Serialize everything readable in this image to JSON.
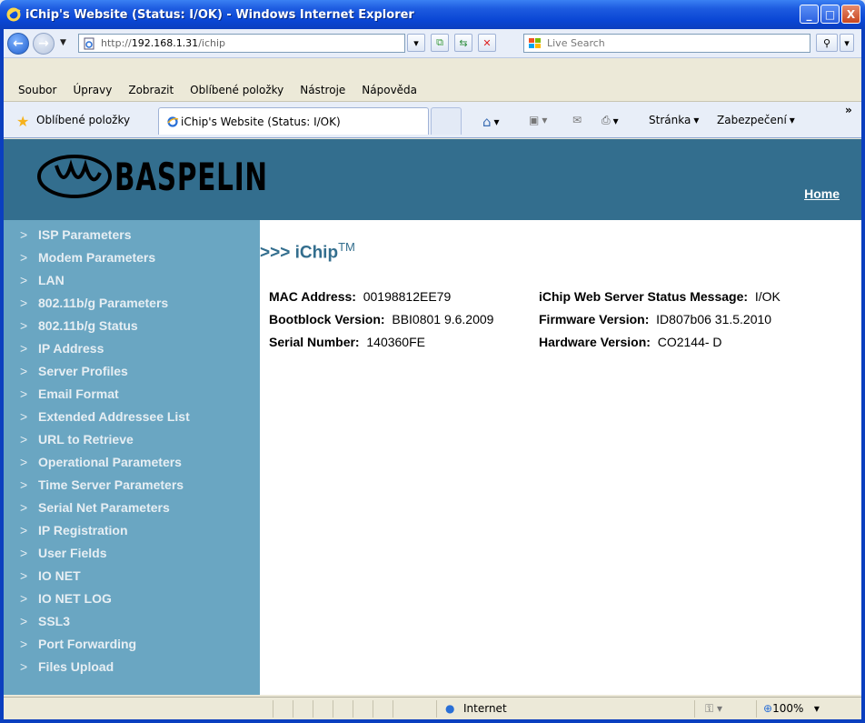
{
  "window": {
    "title": "iChip's Website (Status: I/OK) - Windows Internet Explorer",
    "buttons": [
      "_",
      "□",
      "X"
    ]
  },
  "address_bar": {
    "url_prefix": "http://",
    "url_host": "192.168.1.31",
    "url_path": "/ichip",
    "search_placeholder": "Live Search"
  },
  "menu": [
    "Soubor",
    "Úpravy",
    "Zobrazit",
    "Oblíbené položky",
    "Nástroje",
    "Nápověda"
  ],
  "favorites_bar": {
    "favorites_label": "Oblíbené položky",
    "tab_title": "iChip's Website (Status: I/OK)",
    "page_label": "Stránka",
    "security_label": "Zabezpečení",
    "more": "»"
  },
  "header": {
    "brand": "BASPELIN",
    "home_link": "Home"
  },
  "sidebar": {
    "arrow": ">",
    "items": [
      "ISP Parameters",
      "Modem Parameters",
      "LAN",
      "802.11b/g Parameters",
      "802.11b/g Status",
      "IP Address",
      "Server Profiles",
      "Email Format",
      "Extended Addressee List",
      "URL to Retrieve",
      "Operational Parameters",
      "Time Server Parameters",
      "Serial Net Parameters",
      "IP Registration",
      "User Fields",
      "IO NET",
      "IO NET LOG",
      "SSL3",
      "Port Forwarding",
      "Files Upload"
    ]
  },
  "main": {
    "heading": ">>> iChip",
    "trademark": "TM",
    "mac_label": "MAC Address:",
    "mac_value": "00198812EE79",
    "status_label": "iChip Web Server Status Message:",
    "status_value": "I/OK",
    "bootblock_label": "Bootblock Version:",
    "bootblock_value": "BBI0801 9.6.2009",
    "firmware_label": "Firmware Version:",
    "firmware_value": "ID807b06 31.5.2010",
    "serial_label": "Serial Number:",
    "serial_value": "140360FE",
    "hardware_label": "Hardware Version:",
    "hardware_value": "CO2144- D"
  },
  "status_bar": {
    "zone": "Internet",
    "zoom": "100%"
  },
  "colors": {
    "header_bg": "#336e8e",
    "sidebar_bg": "#6aa6c2",
    "sidebar_text": "#e6eef3",
    "heading_color": "#336e8e"
  }
}
